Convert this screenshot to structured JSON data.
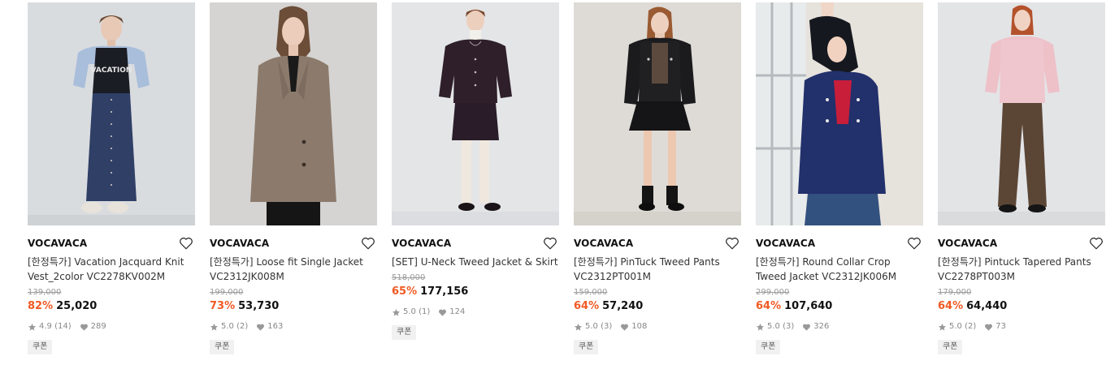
{
  "colors": {
    "discount": "#f15a22",
    "accent": "#111111"
  },
  "products": [
    {
      "brand": "VOCAVACA",
      "name": "[한정특가] Vacation Jacquard Knit Vest_2color VC2278KV002M",
      "orig_price": "139,000",
      "discount": "82%",
      "price": "25,020",
      "rating": "4.9",
      "reviews": "(14)",
      "likes": "289",
      "coupon": "쿠폰"
    },
    {
      "brand": "VOCAVACA",
      "name": "[한정특가] Loose fit Single Jacket VC2312JK008M",
      "orig_price": "199,000",
      "discount": "73%",
      "price": "53,730",
      "rating": "5.0",
      "reviews": "(2)",
      "likes": "163",
      "coupon": "쿠폰"
    },
    {
      "brand": "VOCAVACA",
      "name": "[SET] U-Neck Tweed Jacket & Skirt",
      "orig_price": "518,000",
      "discount": "65%",
      "price": "177,156",
      "rating": "5.0",
      "reviews": "(1)",
      "likes": "124",
      "coupon": "쿠폰"
    },
    {
      "brand": "VOCAVACA",
      "name": "[한정특가] PinTuck Tweed Pants VC2312PT001M",
      "orig_price": "159,000",
      "discount": "64%",
      "price": "57,240",
      "rating": "5.0",
      "reviews": "(3)",
      "likes": "108",
      "coupon": "쿠폰"
    },
    {
      "brand": "VOCAVACA",
      "name": "[한정특가] Round Collar Crop Tweed Jacket VC2312JK006M",
      "orig_price": "299,000",
      "discount": "64%",
      "price": "107,640",
      "rating": "5.0",
      "reviews": "(3)",
      "likes": "326",
      "coupon": "쿠폰"
    },
    {
      "brand": "VOCAVACA",
      "name": "[한정특가] Pintuck Tapered Pants VC2278PT003M",
      "orig_price": "179,000",
      "discount": "64%",
      "price": "64,440",
      "rating": "5.0",
      "reviews": "(2)",
      "likes": "73",
      "coupon": "쿠폰"
    }
  ]
}
